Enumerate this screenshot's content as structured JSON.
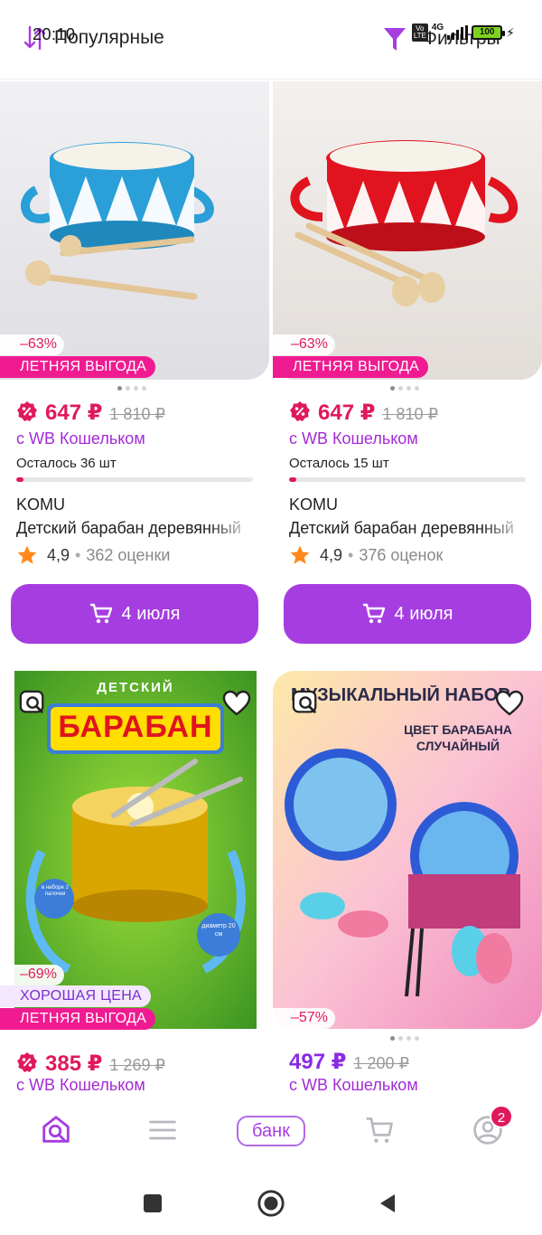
{
  "status_bar": {
    "time": "20:10",
    "network": "4G",
    "volte": "Vo LTE",
    "battery": "100"
  },
  "header": {
    "sort_label": "Популярные",
    "filter_label": "Фильтры"
  },
  "products": [
    {
      "discount": "–63%",
      "promo": "ЛЕТНЯЯ ВЫГОДА",
      "price": "647 ₽",
      "old_price": "1 810 ₽",
      "wallet_text": "с WB Кошельком",
      "stock_text": "Осталось 36 шт",
      "stock_fill": 0.03,
      "brand": "KOMU",
      "title": "Детский барабан деревянный",
      "rating": "4,9",
      "reviews": "362 оценки",
      "delivery": "4 июля",
      "drum_color": "#2a9fd8"
    },
    {
      "discount": "–63%",
      "promo": "ЛЕТНЯЯ ВЫГОДА",
      "price": "647 ₽",
      "old_price": "1 810 ₽",
      "wallet_text": "с WB Кошельком",
      "stock_text": "Осталось 15 шт",
      "stock_fill": 0.03,
      "brand": "KOMU",
      "title": "Детский барабан деревянный",
      "rating": "4,9",
      "reviews": "376 оценок",
      "delivery": "4 июля",
      "drum_color": "#e0131f"
    },
    {
      "discount": "–69%",
      "good_price": "ХОРОШАЯ ЦЕНА",
      "promo": "ЛЕТНЯЯ ВЫГОДА",
      "price": "385 ₽",
      "old_price": "1 269 ₽",
      "wallet_text": "с WB Кошельком",
      "image_top": "ДЕТСКИЙ",
      "image_title": "БАРАБАН",
      "image_note1": "в наборе 2 палочки",
      "image_note2": "диаметр 20 см"
    },
    {
      "discount": "–57%",
      "price": "497 ₽",
      "old_price": "1 200 ₽",
      "wallet_text": "с WB Кошельком",
      "image_top": "МУЗЫКАЛЬНЫЙ НАБОР",
      "image_sub": "ЦВЕТ БАРАБАНА СЛУЧАЙНЫЙ"
    }
  ],
  "bottom_nav": {
    "bank_label": "банк",
    "profile_badge": "2"
  },
  "colors": {
    "accent": "#a53de0",
    "sale": "#e0195a",
    "promo": "#f01b91"
  }
}
